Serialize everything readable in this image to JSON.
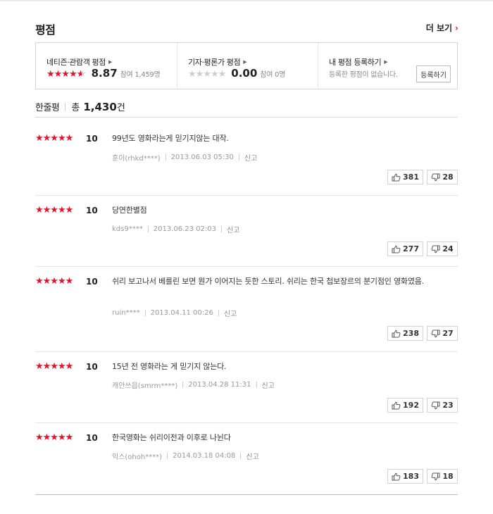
{
  "header": {
    "title": "평점",
    "more_label": "더 보기"
  },
  "ratings": [
    {
      "label": "네티즌·관람객 평점",
      "stars": 4.5,
      "score": "8.87",
      "participants": "참여 1,459명"
    },
    {
      "label": "기자·평론가 평점",
      "stars": 0,
      "score": "0.00",
      "participants": "참여 0명"
    },
    {
      "label": "내 평점 등록하기",
      "note": "등록한 평점이 없습니다.",
      "button": "등록하기"
    }
  ],
  "comments_header": {
    "label": "한줄평",
    "total_prefix": "총",
    "count": "1,430",
    "unit": "건"
  },
  "reviews": [
    {
      "stars": 5,
      "score": "10",
      "text": "99년도 영화라는게 믿기지않는 대작.",
      "author": "훈이(rhkd****)",
      "date": "2013.06.03 05:30",
      "report": "신고",
      "likes": "381",
      "dislikes": "28"
    },
    {
      "stars": 5,
      "score": "10",
      "text": "당연한별점",
      "author": "kds9****",
      "date": "2013.06.23 02:03",
      "report": "신고",
      "likes": "277",
      "dislikes": "24"
    },
    {
      "stars": 5,
      "score": "10",
      "text": "쉬리 보고나서 베를린 보면 뭔가 이어지는 듯한 스토리. 쉬리는 한국 첩보장르의 분기점인 영화였음.",
      "author": "ruin****",
      "date": "2013.04.11 00:26",
      "report": "신고",
      "likes": "238",
      "dislikes": "27"
    },
    {
      "stars": 5,
      "score": "10",
      "text": "15년 전 영화라는 게 믿기지 않는다.",
      "author": "캐안쓰읍(smrm****)",
      "date": "2013.04.28 11:31",
      "report": "신고",
      "likes": "192",
      "dislikes": "23"
    },
    {
      "stars": 5,
      "score": "10",
      "text": "한국영화는 쉬리이전과 이후로 나뉜다",
      "author": "익스(ohoh****)",
      "date": "2014.03.18 04:08",
      "report": "신고",
      "likes": "183",
      "dislikes": "18"
    }
  ],
  "icons": {
    "like": "thumbs-up-icon",
    "dislike": "thumbs-down-icon",
    "more": "chevron-right-icon"
  },
  "colors": {
    "accent": "#e8112d"
  }
}
